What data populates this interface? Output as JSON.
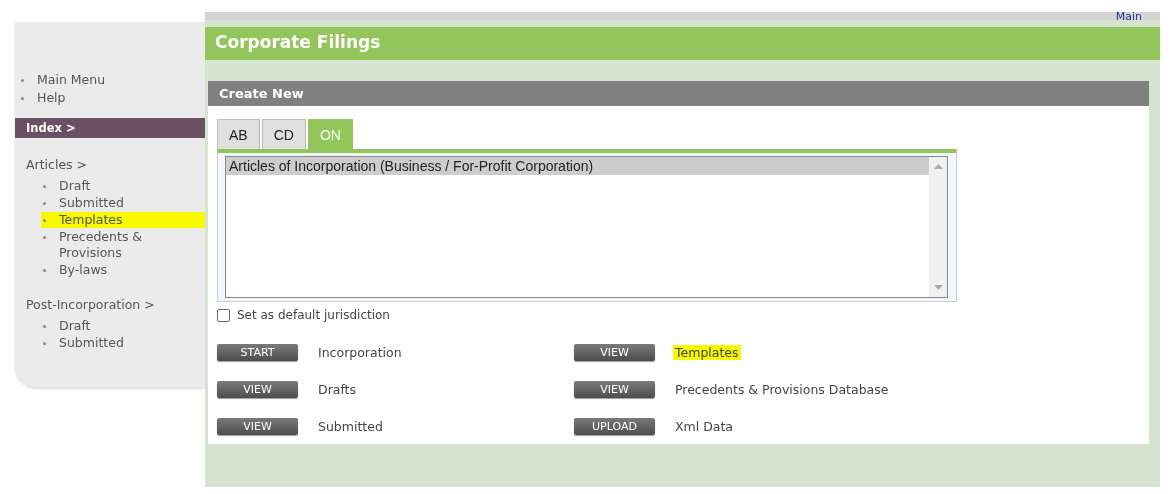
{
  "header_link": "Main",
  "title": "Corporate Filings",
  "sidebar": {
    "top_links": [
      {
        "label": "Main Menu"
      },
      {
        "label": "Help"
      }
    ],
    "index_label": "Index >",
    "sections": [
      {
        "title": "Articles >",
        "items": [
          {
            "label": "Draft",
            "highlighted": false
          },
          {
            "label": "Submitted",
            "highlighted": false
          },
          {
            "label": "Templates",
            "highlighted": true
          },
          {
            "label": "Precedents & Provisions",
            "highlighted": false
          },
          {
            "label": "By-laws",
            "highlighted": false
          }
        ]
      },
      {
        "title": "Post-Incorporation >",
        "items": [
          {
            "label": "Draft",
            "highlighted": false
          },
          {
            "label": "Submitted",
            "highlighted": false
          }
        ]
      }
    ]
  },
  "create_new": {
    "title": "Create New",
    "tabs": [
      {
        "label": "AB",
        "selected": false
      },
      {
        "label": "CD",
        "selected": false
      },
      {
        "label": "ON",
        "selected": true
      }
    ],
    "options": [
      {
        "label": "Articles of Incorporation (Business / For-Profit Corporation)",
        "selected": true
      }
    ],
    "default_jurisdiction": {
      "label": "Set as default jurisdiction",
      "checked": false
    }
  },
  "actions": [
    {
      "button": "START",
      "label": "Incorporation",
      "highlighted": false
    },
    {
      "button": "VIEW",
      "label": "Templates",
      "highlighted": true
    },
    {
      "button": "VIEW",
      "label": "Drafts",
      "highlighted": false
    },
    {
      "button": "VIEW",
      "label": "Precedents & Provisions Database",
      "highlighted": false
    },
    {
      "button": "VIEW",
      "label": "Submitted",
      "highlighted": false
    },
    {
      "button": "UPLOAD",
      "label": "Xml Data",
      "highlighted": false
    }
  ]
}
